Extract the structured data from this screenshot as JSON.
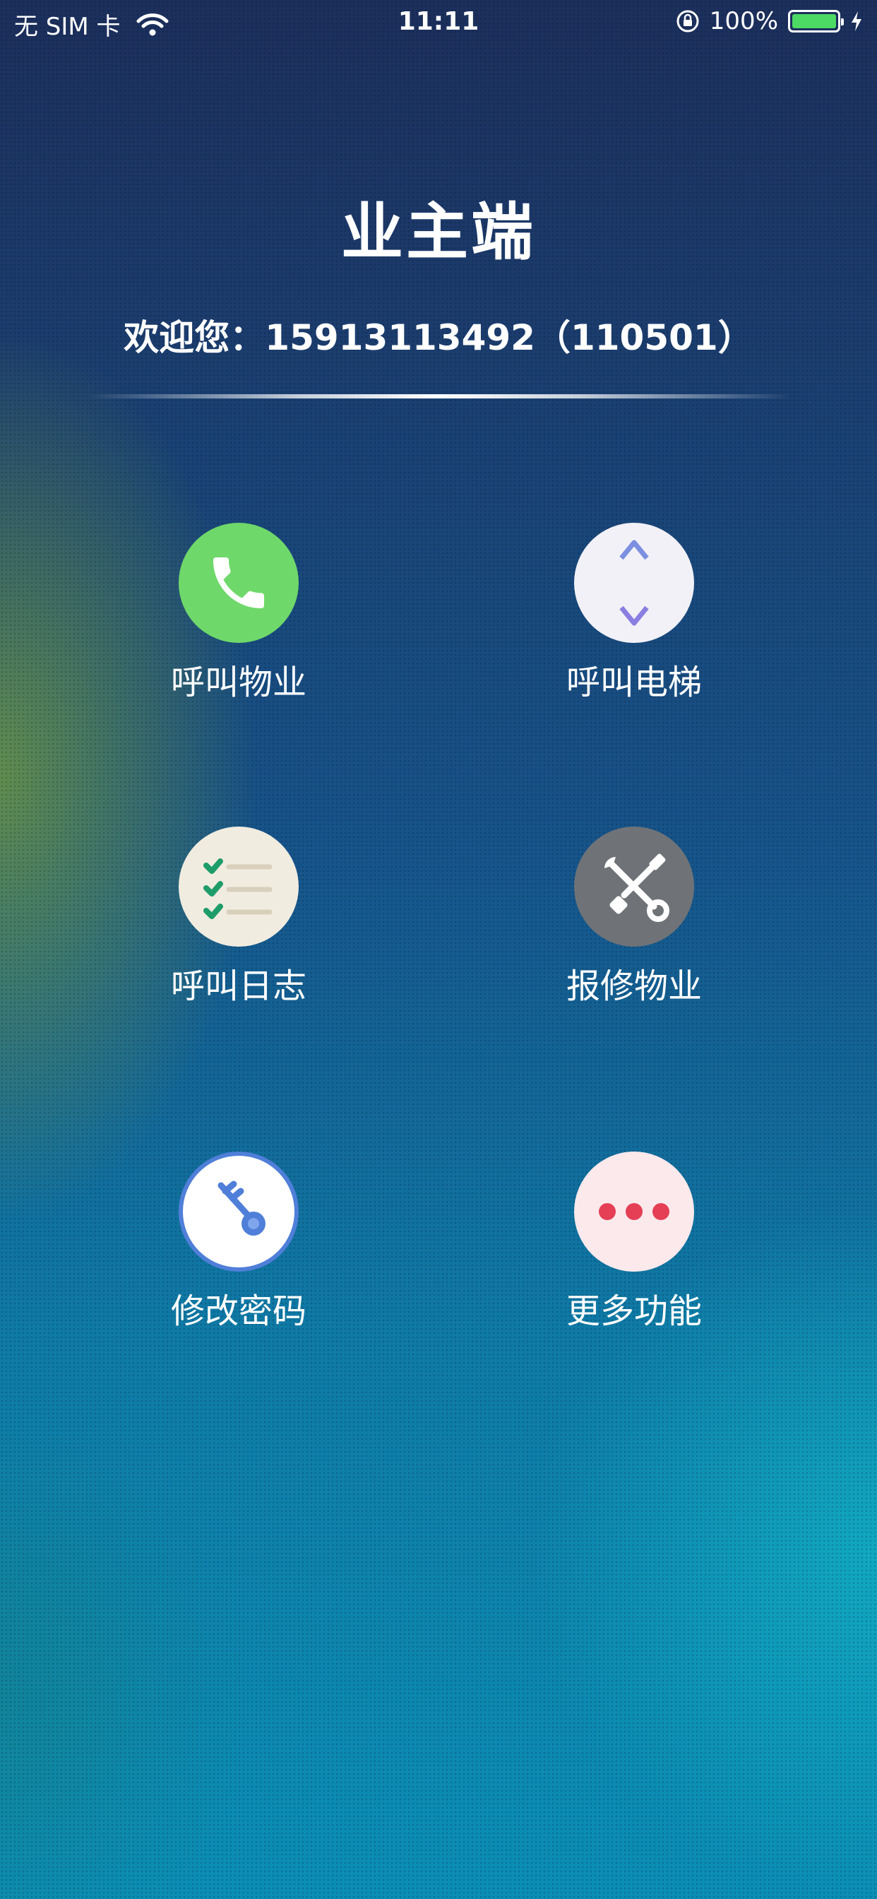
{
  "status_bar": {
    "carrier": "无 SIM 卡",
    "time": "11:11",
    "battery": "100%",
    "battery_level": 1.0
  },
  "header": {
    "title": "业主端",
    "welcome": "欢迎您：15913113492（110501）"
  },
  "menu": [
    {
      "label": "呼叫物业",
      "icon": "phone-icon",
      "color": "#6fd86a"
    },
    {
      "label": "呼叫电梯",
      "icon": "elevator-arrows-icon",
      "color": "#f2f1f7"
    },
    {
      "label": "呼叫日志",
      "icon": "checklist-icon",
      "color": "#f1ece0"
    },
    {
      "label": "报修物业",
      "icon": "tools-icon",
      "color": "#6f7377"
    },
    {
      "label": "修改密码",
      "icon": "key-icon",
      "color": "#ffffff"
    },
    {
      "label": "更多功能",
      "icon": "more-dots-icon",
      "color": "#fbe9ec"
    }
  ]
}
